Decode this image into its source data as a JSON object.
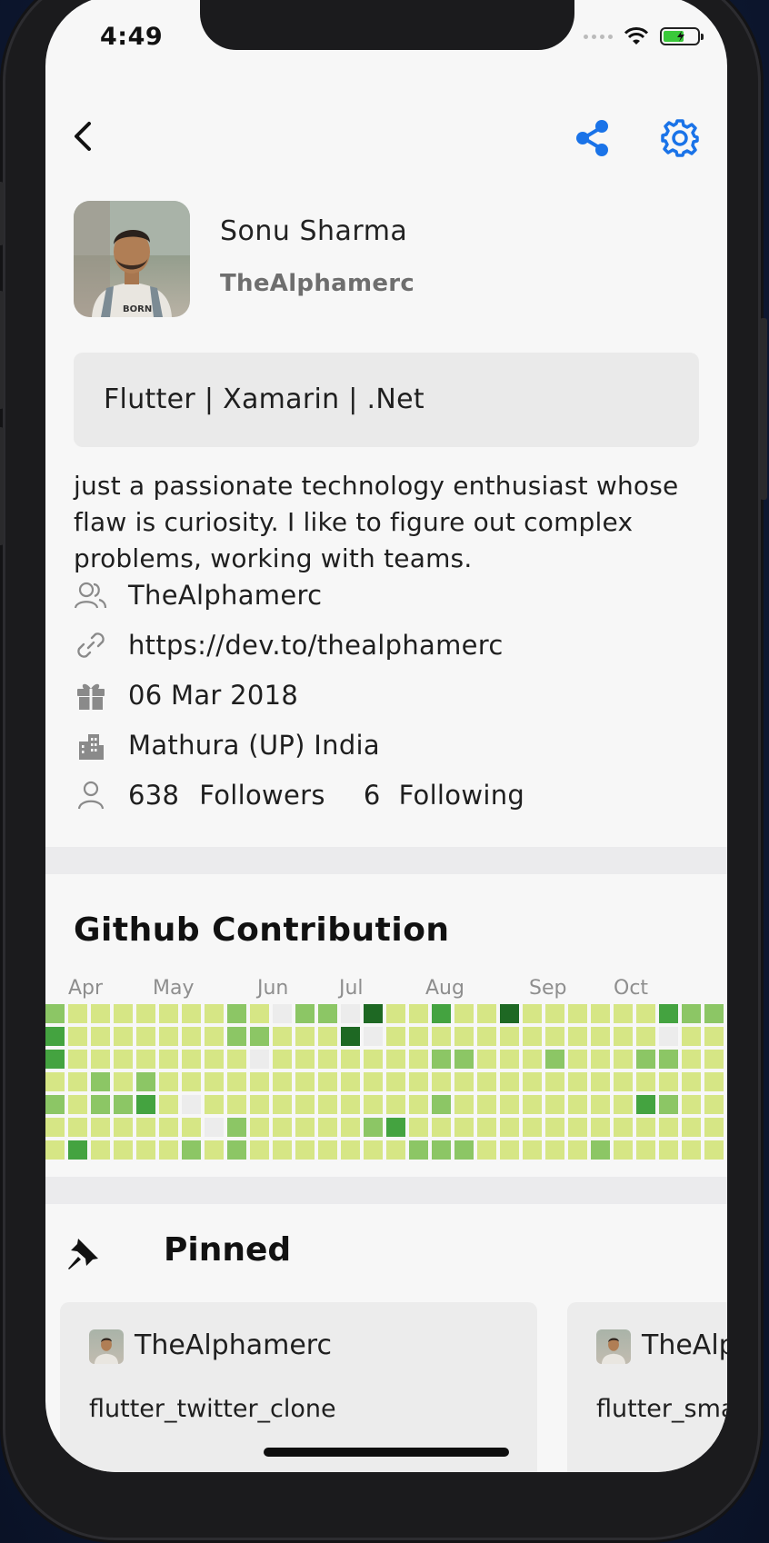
{
  "status_bar": {
    "time": "4:49"
  },
  "profile": {
    "name": "Sonu Sharma",
    "login": "TheAlphamerc",
    "company": "Flutter | Xamarin | .Net",
    "bio": "just a passionate technology enthusiast whose flaw is curiosity. I like to figure out complex problems, working with teams.",
    "info": {
      "username": "TheAlphamerc",
      "website": "https://dev.to/thealphamerc",
      "joined": "06 Mar 2018",
      "location": "Mathura (UP) India",
      "followers_count": "638",
      "followers_label": "Followers",
      "following_count": "6",
      "following_label": "Following"
    }
  },
  "contributions": {
    "title": "Github Contribution",
    "months": [
      "Apr",
      "May",
      "Jun",
      "Jul",
      "Aug",
      "Sep",
      "Oct"
    ],
    "levels_palette": [
      "#ececec",
      "#d6e685",
      "#8cc665",
      "#44a340",
      "#1e6823"
    ],
    "weeks": [
      [
        2,
        3,
        3,
        1,
        2,
        1,
        1
      ],
      [
        1,
        1,
        1,
        1,
        1,
        1,
        3
      ],
      [
        1,
        1,
        1,
        2,
        2,
        1,
        1
      ],
      [
        1,
        1,
        1,
        1,
        2,
        1,
        1
      ],
      [
        1,
        1,
        1,
        2,
        3,
        1,
        1
      ],
      [
        1,
        1,
        1,
        1,
        1,
        1,
        1
      ],
      [
        1,
        1,
        1,
        1,
        0,
        1,
        2
      ],
      [
        1,
        1,
        1,
        1,
        1,
        0,
        1
      ],
      [
        2,
        2,
        1,
        1,
        1,
        2,
        2
      ],
      [
        1,
        2,
        0,
        1,
        1,
        1,
        1
      ],
      [
        0,
        1,
        1,
        1,
        1,
        1,
        1
      ],
      [
        2,
        1,
        1,
        1,
        1,
        1,
        1
      ],
      [
        2,
        1,
        1,
        1,
        1,
        1,
        1
      ],
      [
        0,
        4,
        1,
        1,
        1,
        1,
        1
      ],
      [
        4,
        0,
        1,
        1,
        1,
        2,
        1
      ],
      [
        1,
        1,
        1,
        1,
        1,
        3,
        1
      ],
      [
        1,
        1,
        1,
        1,
        1,
        1,
        2
      ],
      [
        3,
        1,
        2,
        1,
        2,
        1,
        2
      ],
      [
        1,
        1,
        2,
        1,
        1,
        1,
        2
      ],
      [
        1,
        1,
        1,
        1,
        1,
        1,
        1
      ],
      [
        4,
        1,
        1,
        1,
        1,
        1,
        1
      ],
      [
        1,
        1,
        1,
        1,
        1,
        1,
        1
      ],
      [
        1,
        1,
        2,
        1,
        1,
        1,
        1
      ],
      [
        1,
        1,
        1,
        1,
        1,
        1,
        1
      ],
      [
        1,
        1,
        1,
        1,
        1,
        1,
        2
      ],
      [
        1,
        1,
        1,
        1,
        1,
        1,
        1
      ],
      [
        1,
        1,
        2,
        1,
        3,
        1,
        1
      ],
      [
        3,
        0,
        2,
        1,
        2,
        1,
        1
      ],
      [
        2,
        1,
        1,
        1,
        1,
        1,
        1
      ],
      [
        2,
        1,
        1,
        1,
        1,
        1,
        1
      ],
      [
        2,
        1,
        1
      ]
    ]
  },
  "pinned": {
    "title": "Pinned",
    "cards": [
      {
        "owner": "TheAlphamerc",
        "repo": "flutter_twitter_clone"
      },
      {
        "owner": "TheAlphamerc",
        "repo": "flutter_smart_course"
      }
    ]
  },
  "colors": {
    "accent": "#1a73e8",
    "icon_gray": "#8a8a8a"
  },
  "icons": [
    "back-icon",
    "share-icon",
    "settings-gear-icon",
    "users-icon",
    "link-icon",
    "gift-icon",
    "building-icon",
    "person-icon",
    "pin-icon"
  ]
}
